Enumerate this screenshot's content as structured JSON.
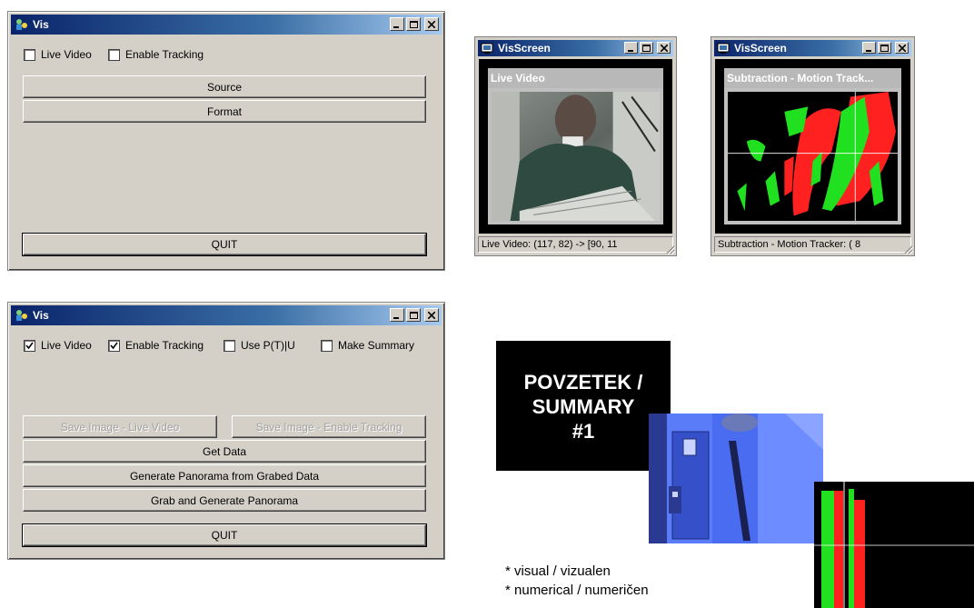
{
  "window1": {
    "title": "Vis",
    "checkboxes": [
      {
        "label": "Live Video",
        "checked": false
      },
      {
        "label": "Enable Tracking",
        "checked": false
      }
    ],
    "buttons": {
      "source": "Source",
      "format": "Format",
      "quit": "QUIT"
    }
  },
  "window2": {
    "title": "Vis",
    "checkboxes": [
      {
        "label": "Live Video",
        "checked": true
      },
      {
        "label": "Enable Tracking",
        "checked": true
      },
      {
        "label": "Use P(T)|U",
        "checked": false
      },
      {
        "label": "Make Summary",
        "checked": false
      }
    ],
    "buttons": {
      "save_live": "Save Image - Live Video",
      "save_tracking": "Save Image - Enable Tracking",
      "get_data": "Get Data",
      "generate_panorama": "Generate Panorama from Grabed Data",
      "grab_generate": "Grab and Generate Panorama",
      "quit": "QUIT"
    }
  },
  "visscreen_live": {
    "title": "VisScreen",
    "caption": "Live Video",
    "status": "Live Video:  (117,  82) -> [90, 11"
  },
  "visscreen_tracker": {
    "title": "VisScreen",
    "caption": "Subtraction - Motion Track...",
    "status": "Subtraction - Motion Tracker:  ( 8"
  },
  "summary": {
    "lines": [
      "POVZETEK /",
      "SUMMARY",
      "#1"
    ],
    "bullets": [
      "* visual / vizualen",
      "* numerical / numeričen"
    ]
  },
  "colors": {
    "titlebar_start": "#0a246a",
    "titlebar_end": "#a6caf0",
    "face": "#d4d0c8",
    "tracker_red": "#ff2020",
    "tracker_green": "#20e020"
  }
}
